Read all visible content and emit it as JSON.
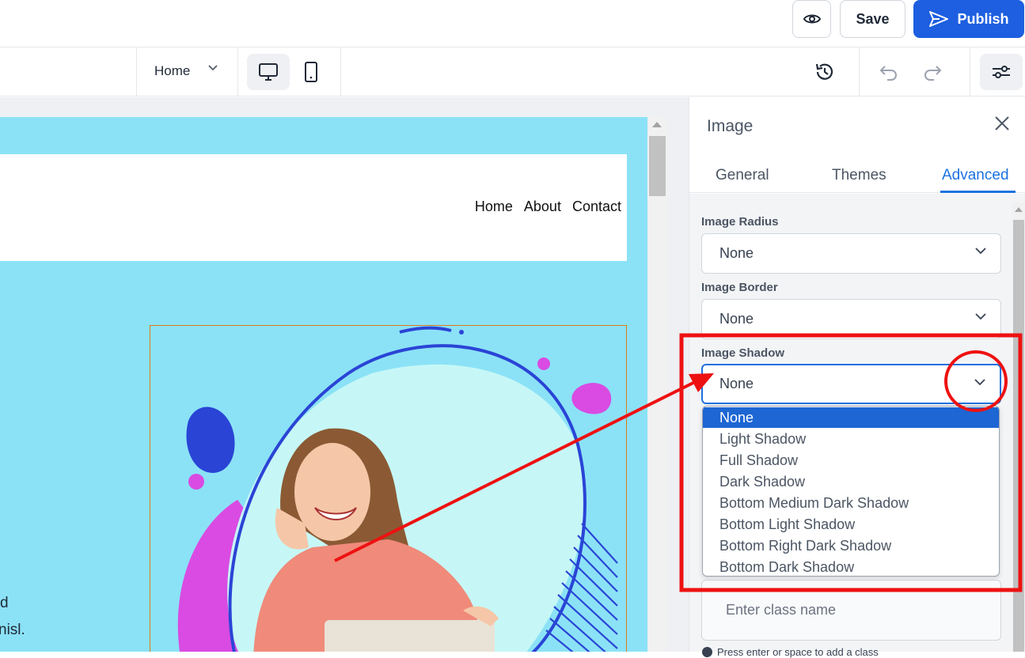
{
  "header": {
    "save_label": "Save",
    "publish_label": "Publish"
  },
  "toolbar": {
    "page_select_value": "Home"
  },
  "preview": {
    "nav": [
      "Home",
      "About",
      "Contact"
    ],
    "hero_text_lines": [
      "d",
      "nisl."
    ]
  },
  "panel": {
    "title": "Image",
    "tabs": [
      "General",
      "Themes",
      "Advanced"
    ],
    "active_tab": "Advanced",
    "fields": {
      "radius_label": "Image Radius",
      "radius_value": "None",
      "border_label": "Image Border",
      "border_value": "None",
      "shadow_label": "Image Shadow",
      "shadow_value": "None"
    },
    "class_placeholder": "Enter class name",
    "hint": "Press enter or space to add a class"
  },
  "shadow_options": [
    "None",
    "Light Shadow",
    "Full Shadow",
    "Dark Shadow",
    "Bottom Medium Dark Shadow",
    "Bottom Light Shadow",
    "Bottom Right Dark Shadow",
    "Bottom Dark Shadow"
  ],
  "colors": {
    "accent": "#1d5fe0",
    "canvas_bg": "#8be2f6",
    "annotation": "#ee1111"
  }
}
